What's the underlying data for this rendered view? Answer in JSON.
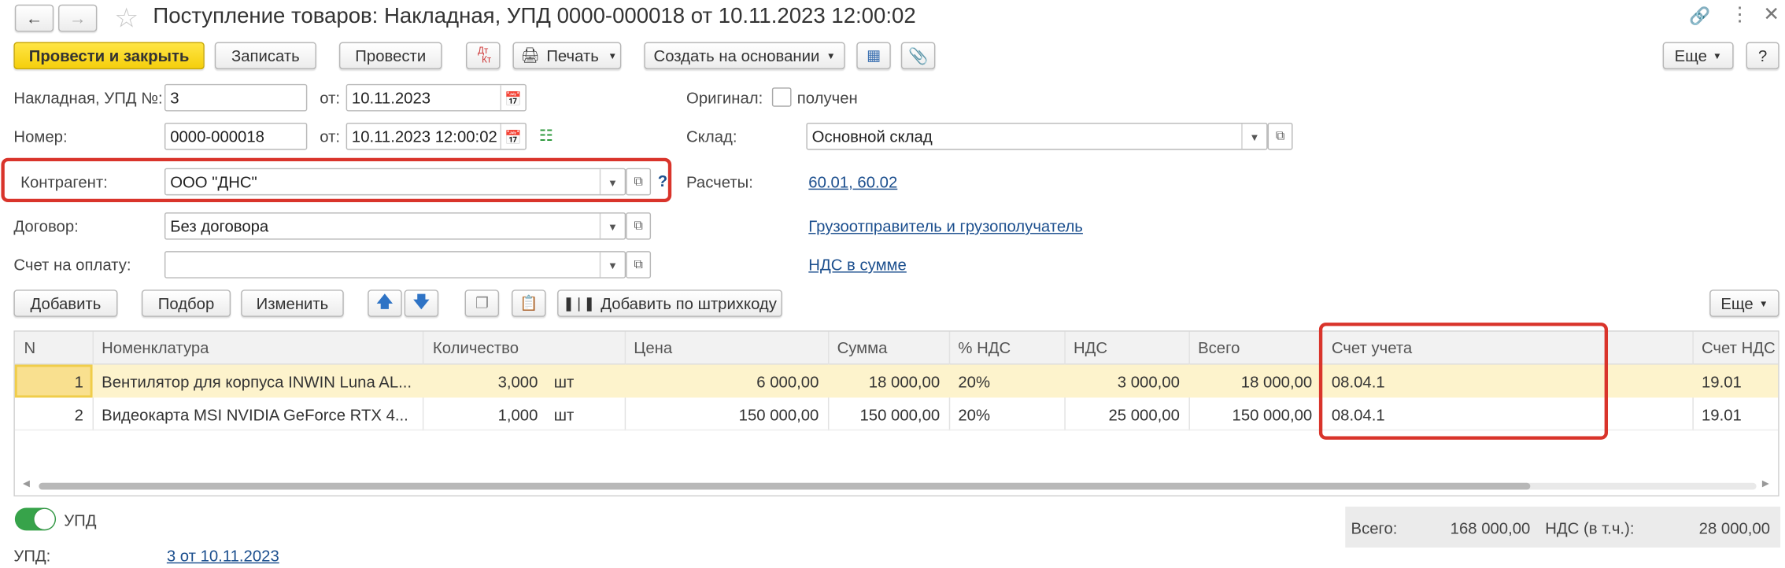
{
  "window": {
    "title": "Поступление товаров: Накладная, УПД 0000-000018 от 10.11.2023 12:00:02"
  },
  "toolbar": {
    "post_close": "Провести и закрыть",
    "save": "Записать",
    "post": "Провести",
    "dtkt_icon_top": "Дт",
    "dtkt_icon_bottom": "Кт",
    "print": "Печать",
    "create_based": "Создать на основании",
    "more": "Еще",
    "help": "?"
  },
  "header": {
    "invoice_label": "Накладная, УПД №:",
    "invoice_value": "3",
    "from_label": "от:",
    "invoice_date": "10.11.2023",
    "number_label": "Номер:",
    "number_value": "0000-000018",
    "number_date": "10.11.2023 12:00:02",
    "original_label": "Оригинал:",
    "original_checkbox": "получен",
    "warehouse_label": "Склад:",
    "warehouse_value": "Основной склад",
    "contractor_label": "Контрагент:",
    "contractor_value": "ООО \"ДНС\"",
    "contractor_help": "?",
    "settlements_label": "Расчеты:",
    "settlements_value": "60.01, 60.02",
    "contract_label": "Договор:",
    "contract_value": "Без договора",
    "shipper_link": "Грузоотправитель и грузополучатель",
    "payment_invoice_label": "Счет на оплату:",
    "payment_invoice_value": "",
    "vat_link": "НДС в сумме"
  },
  "table_toolbar": {
    "add": "Добавить",
    "pick": "Подбор",
    "change": "Изменить",
    "add_barcode": "Добавить по штрихкоду",
    "more": "Еще"
  },
  "table": {
    "headers": [
      "N",
      "Номенклатура",
      "Количество",
      "Цена",
      "Сумма",
      "% НДС",
      "НДС",
      "Всего",
      "Счет учета",
      "Счет НДС"
    ],
    "rows": [
      {
        "n": "1",
        "item": "Вентилятор для корпуса INWIN Luna AL...",
        "qty": "3,000",
        "unit": "шт",
        "price": "6 000,00",
        "sum": "18 000,00",
        "vat_rate": "20%",
        "vat": "3 000,00",
        "total": "18 000,00",
        "account": "08.04.1",
        "vat_account": "19.01"
      },
      {
        "n": "2",
        "item": "Видеокарта MSI NVIDIA GeForce RTX 4...",
        "qty": "1,000",
        "unit": "шт",
        "price": "150 000,00",
        "sum": "150 000,00",
        "vat_rate": "20%",
        "vat": "25 000,00",
        "total": "150 000,00",
        "account": "08.04.1",
        "vat_account": "19.01"
      }
    ]
  },
  "footer": {
    "upd_toggle": "УПД",
    "upd_label": "УПД:",
    "upd_link": "3 от 10.11.2023",
    "total_label": "Всего:",
    "total_value": "168 000,00",
    "vat_label": "НДС (в т.ч.):",
    "vat_value": "28 000,00"
  },
  "colors": {
    "accent": "#f5cf0c",
    "highlight_box": "#d9342b",
    "link": "#1c4f8e",
    "selected_row": "#fdf3cc",
    "toggle_on": "#37a34a"
  }
}
